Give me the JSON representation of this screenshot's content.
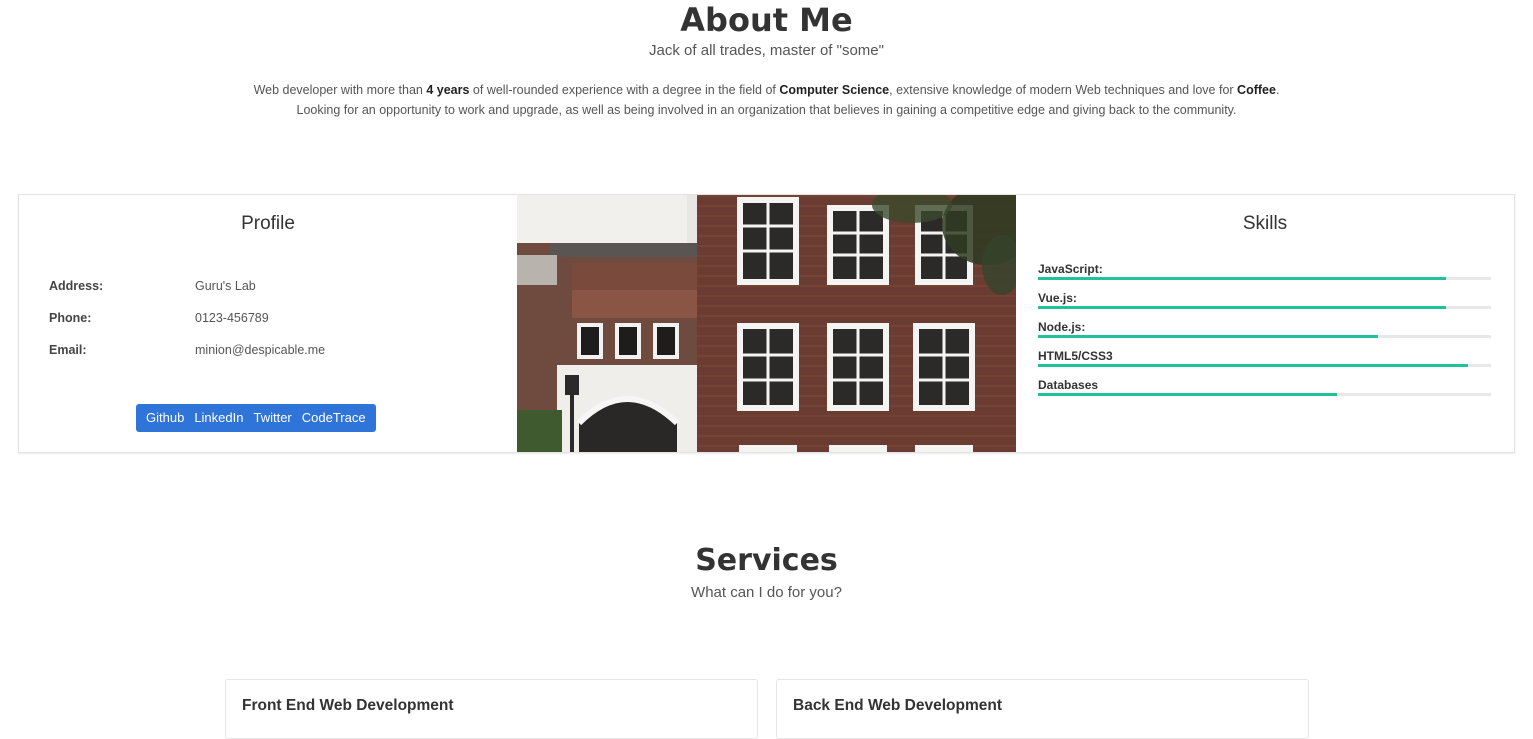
{
  "about": {
    "title": "About Me",
    "subtitle": "Jack of all trades, master of \"some\"",
    "bio_line1": {
      "p1": "Web developer with more than ",
      "b1": "4 years",
      "p2": " of well-rounded experience with a degree in the field of ",
      "b2": "Computer Science",
      "p3": ", extensive knowledge of modern Web techniques and love for ",
      "b3": "Coffee",
      "p4": "."
    },
    "bio_line2": "Looking for an opportunity to work and upgrade, as well as being involved in an organization that believes in gaining a competitive edge and giving back to the community."
  },
  "profile": {
    "title": "Profile",
    "rows": [
      {
        "label": "Address:",
        "value": "Guru's Lab"
      },
      {
        "label": "Phone:",
        "value": "0123-456789"
      },
      {
        "label": "Email:",
        "value": "minion@despicable.me"
      }
    ],
    "links": [
      "Github",
      "LinkedIn",
      "Twitter",
      "CodeTrace"
    ]
  },
  "skills": {
    "title": "Skills",
    "items": [
      {
        "name": "JavaScript:",
        "level": 0.9
      },
      {
        "name": "Vue.js:",
        "level": 0.9
      },
      {
        "name": "Node.js:",
        "level": 0.75
      },
      {
        "name": "HTML5/CSS3",
        "level": 0.95
      },
      {
        "name": "Databases",
        "level": 0.66
      }
    ],
    "bar_color": "#1fc29a"
  },
  "services": {
    "title": "Services",
    "subtitle": "What can I do for you?",
    "cards": [
      "Front End Web Development",
      "Back End Web Development"
    ]
  },
  "colors": {
    "button_group": "#2f74d8",
    "skill_bar": "#1fc29a"
  }
}
